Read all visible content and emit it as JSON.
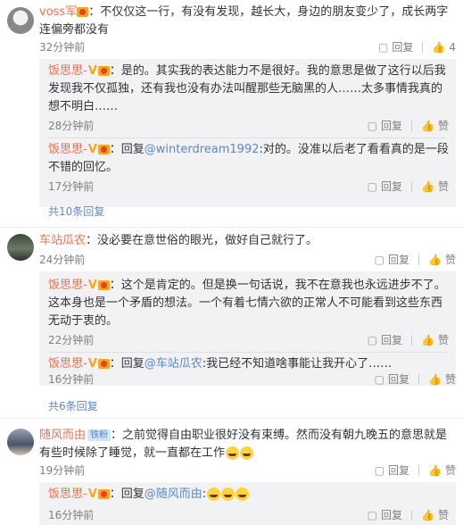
{
  "actions": {
    "reply": "回复",
    "like": "赞"
  },
  "comments": [
    {
      "user": "voss军",
      "text": "：不仅仅这一行，有没有发现，越长大，身边的朋友变少了，成长两字连偏旁都没有",
      "time": "32分钟前",
      "likes": "4",
      "replies": [
        {
          "user": "饭思思-",
          "text": "：是的。其实我的表达能力不是很好。我的意思是做了这行以后我发现我不仅孤独，还有我也没有办法叫醒那些无脑黑的人……太多事情我真的想不明白……",
          "time": "28分钟前"
        },
        {
          "user": "饭思思-",
          "prefix": "：回复",
          "mention": "@winterdream1992",
          "text": ":对的。没准以后老了看看真的是一段不错的回忆。",
          "time": "17分钟前"
        }
      ],
      "more": "共10条回复"
    },
    {
      "user": "车站瓜农",
      "text": "：没必要在意世俗的眼光，做好自己就行了。",
      "time": "24分钟前",
      "replies": [
        {
          "user": "饭思思-",
          "text": "：这个是肯定的。但是换一句话说，我不在意我也永远进步不了。这本身也是一个矛盾的想法。一个有着七情六欲的正常人不可能看到这些东西无动于衷的。",
          "time": "22分钟前"
        },
        {
          "user": "饭思思-",
          "prefix": "：回复",
          "mention": "@车站瓜农",
          "text": ":我已经不知道啥事能让我开心了……",
          "time": "16分钟前"
        }
      ],
      "more": "共6条回复"
    },
    {
      "user": "随风而由",
      "tag": "铁粉",
      "text": "：之前觉得自由职业很好没有束缚。然而没有朝九晚五的意思就是有些时候除了睡觉，就一直都在工作",
      "time": "19分钟前",
      "replies": [
        {
          "user": "饭思思-",
          "prefix": "：回复",
          "mention": "@随风而由",
          "text": ":",
          "time": "16分钟前"
        }
      ]
    }
  ]
}
